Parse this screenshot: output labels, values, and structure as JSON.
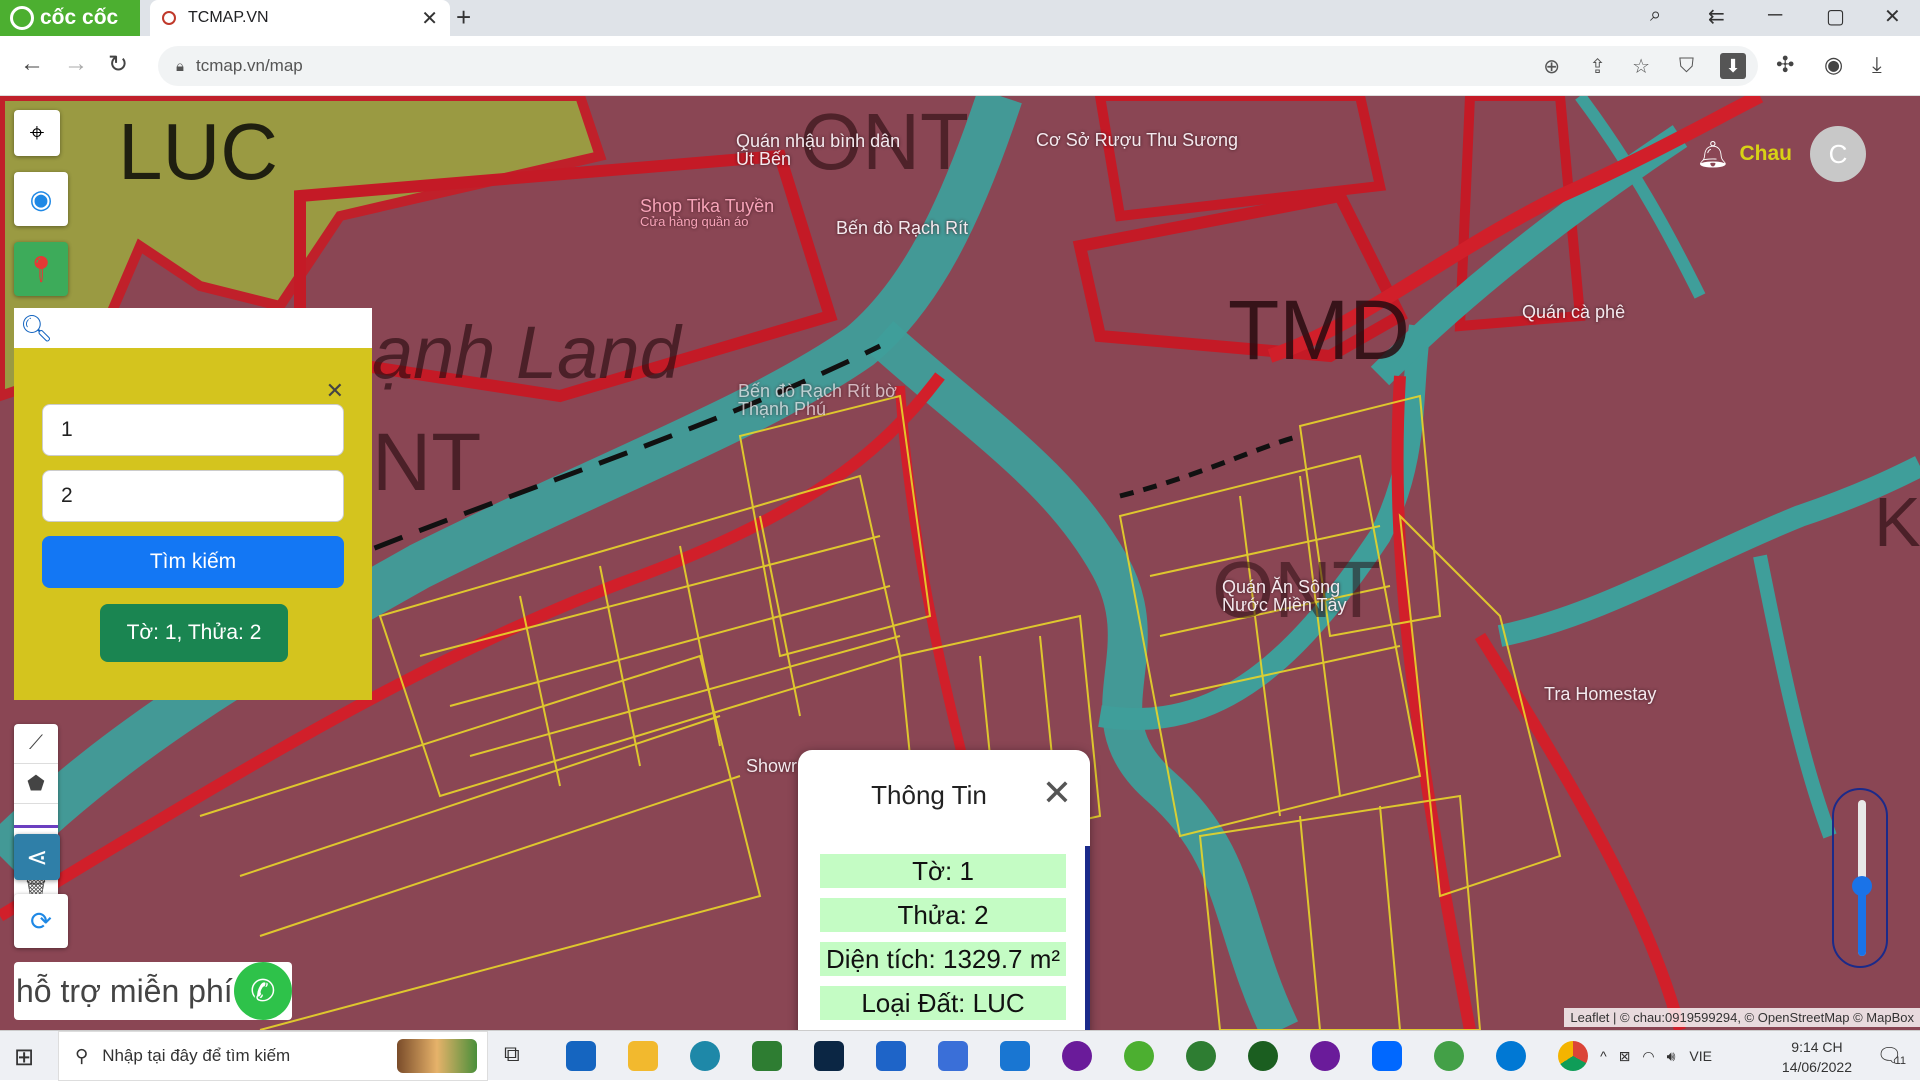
{
  "browser": {
    "brand": "cốc cốc",
    "tab_title": "TCMAP.VN",
    "url": "tcmap.vn/map"
  },
  "map": {
    "zone_labels": [
      "LUC",
      "TMD",
      "ONT",
      "NT",
      "ạnh Land",
      "K"
    ],
    "poi_labels": [
      "Quán nhậu bình dân Út Bến",
      "Cơ Sở Rượu Thu Sương",
      "Shop Tika Tuyền",
      "Cửa hàng quần áo",
      "Bến đò Rạch Rít",
      "Quán cà phê",
      "Bến đò Rạch Rít bờ Thạnh Phú",
      "Quán Ăn Sông Nước Miền Tây",
      "Tra Homestay",
      "Showr"
    ],
    "user": {
      "name": "Chau",
      "avatar_letter": "C"
    },
    "search": {
      "field1": "1",
      "field2": "2",
      "button": "Tìm kiếm",
      "result": "Tờ: 1, Thửa: 2"
    },
    "support_text": "hỗ trợ miễn phí",
    "opacity_level": 0.45,
    "info": {
      "title": "Thông Tin",
      "to": "Tờ: 1",
      "thua": "Thửa: 2",
      "dien_tich": "Diện tích: 1329.7 m²",
      "loai_dat": "Loại Đất: LUC"
    },
    "attribution": "Leaflet | © chau:0919599294, © OpenStreetMap © MapBox"
  },
  "taskbar": {
    "search_placeholder": "Nhập tại đây để tìm kiếm",
    "language": "VIE",
    "time": "9:14 CH",
    "date": "14/06/2022",
    "notif_count": "11"
  }
}
